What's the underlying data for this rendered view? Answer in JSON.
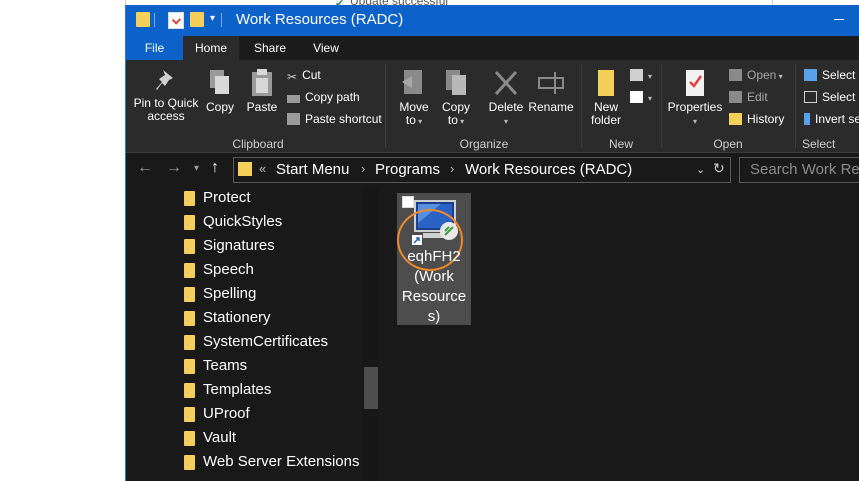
{
  "background": {
    "notification_text": "Update successful"
  },
  "window": {
    "title": "Work Resources (RADC)"
  },
  "ribbon_tabs": {
    "file": "File",
    "home": "Home",
    "share": "Share",
    "view": "View"
  },
  "ribbon": {
    "clipboard": {
      "pin_label_line1": "Pin to Quick",
      "pin_label_line2": "access",
      "copy": "Copy",
      "paste": "Paste",
      "cut": "Cut",
      "copy_path": "Copy path",
      "paste_shortcut": "Paste shortcut",
      "group_label": "Clipboard"
    },
    "organize": {
      "move_to_line1": "Move",
      "move_to_line2": "to",
      "copy_to_line1": "Copy",
      "copy_to_line2": "to",
      "delete": "Delete",
      "rename": "Rename",
      "group_label": "Organize"
    },
    "new": {
      "new_folder_line1": "New",
      "new_folder_line2": "folder",
      "group_label": "New"
    },
    "open": {
      "properties": "Properties",
      "open": "Open",
      "edit": "Edit",
      "history": "History",
      "group_label": "Open"
    },
    "select": {
      "select_all": "Select all",
      "select_none": "Select none",
      "invert_selection": "Invert selection",
      "group_label": "Select"
    }
  },
  "address": {
    "overflow": "«",
    "crumbs": [
      "Start Menu",
      "Programs",
      "Work Resources (RADC)"
    ],
    "separator": "›"
  },
  "search": {
    "placeholder": "Search Work Resources (RADC)"
  },
  "nav_tree": {
    "items": [
      "Protect",
      "QuickStyles",
      "Signatures",
      "Speech",
      "Spelling",
      "Stationery",
      "SystemCertificates",
      "Teams",
      "Templates",
      "UProof",
      "Vault",
      "Web Server Extensions"
    ]
  },
  "files": [
    {
      "name": "eqhFH2 (Work Resources)",
      "name_lines": [
        "eqhFH2",
        "(Work",
        "Resource",
        "s)"
      ],
      "icon": "remote-desktop-shortcut-icon"
    }
  ],
  "colors": {
    "title_bar": "#0c62c9",
    "window_bg": "#191919",
    "ribbon_bg": "#2b2b2b",
    "folder": "#f4cf5a",
    "annotation": "#f08a2a"
  }
}
